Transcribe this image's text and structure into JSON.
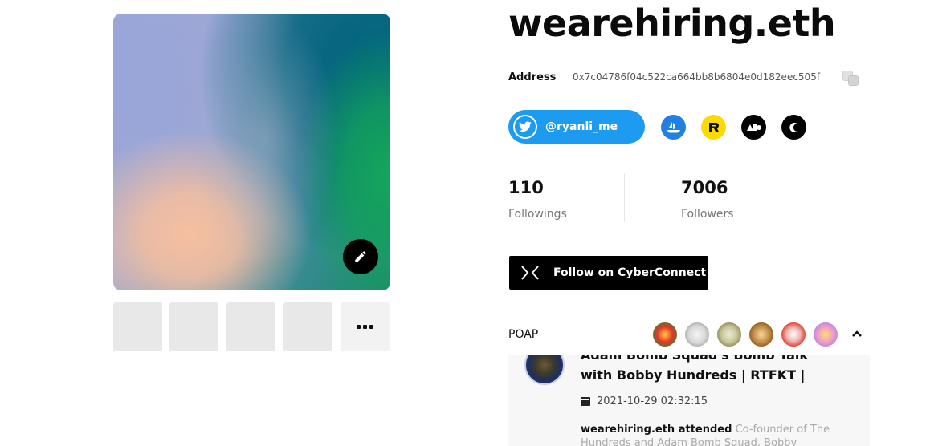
{
  "profile": {
    "name": "wearehiring.eth",
    "address_label": "Address",
    "address": "0x7c04786f04c522ca664bb8b6804e0d182eec505f",
    "twitter_handle": "@ryanli_me"
  },
  "stats": {
    "followings_count": "110",
    "followings_label": "Followings",
    "followers_count": "7006",
    "followers_label": "Followers"
  },
  "follow_button_label": "Follow on CyberConnect",
  "poap": {
    "label": "POAP",
    "event_title": "Adam Bomb Squad's Bomb Talk with Bobby Hundreds | RTFKT |",
    "event_date": "2021-10-29 02:32:15",
    "attendee": "wearehiring.eth attended",
    "description": "Co-founder of The Hundreds and Adam Bomb Squad, Bobby Hundreds, is jol"
  },
  "colors": {
    "twitter": "#1d9bf0",
    "opensea": "#2081e2",
    "rarible": "#feda03",
    "foundation": "#000000",
    "cyberconnect": "#000000"
  },
  "icons": [
    "edit-icon",
    "copy-icon",
    "twitter-icon",
    "opensea-icon",
    "rarible-icon",
    "foundation-icon",
    "cyberconnect-icon",
    "cyberconnect-logo-icon",
    "chevron-up-icon",
    "calendar-icon",
    "more-icon"
  ]
}
